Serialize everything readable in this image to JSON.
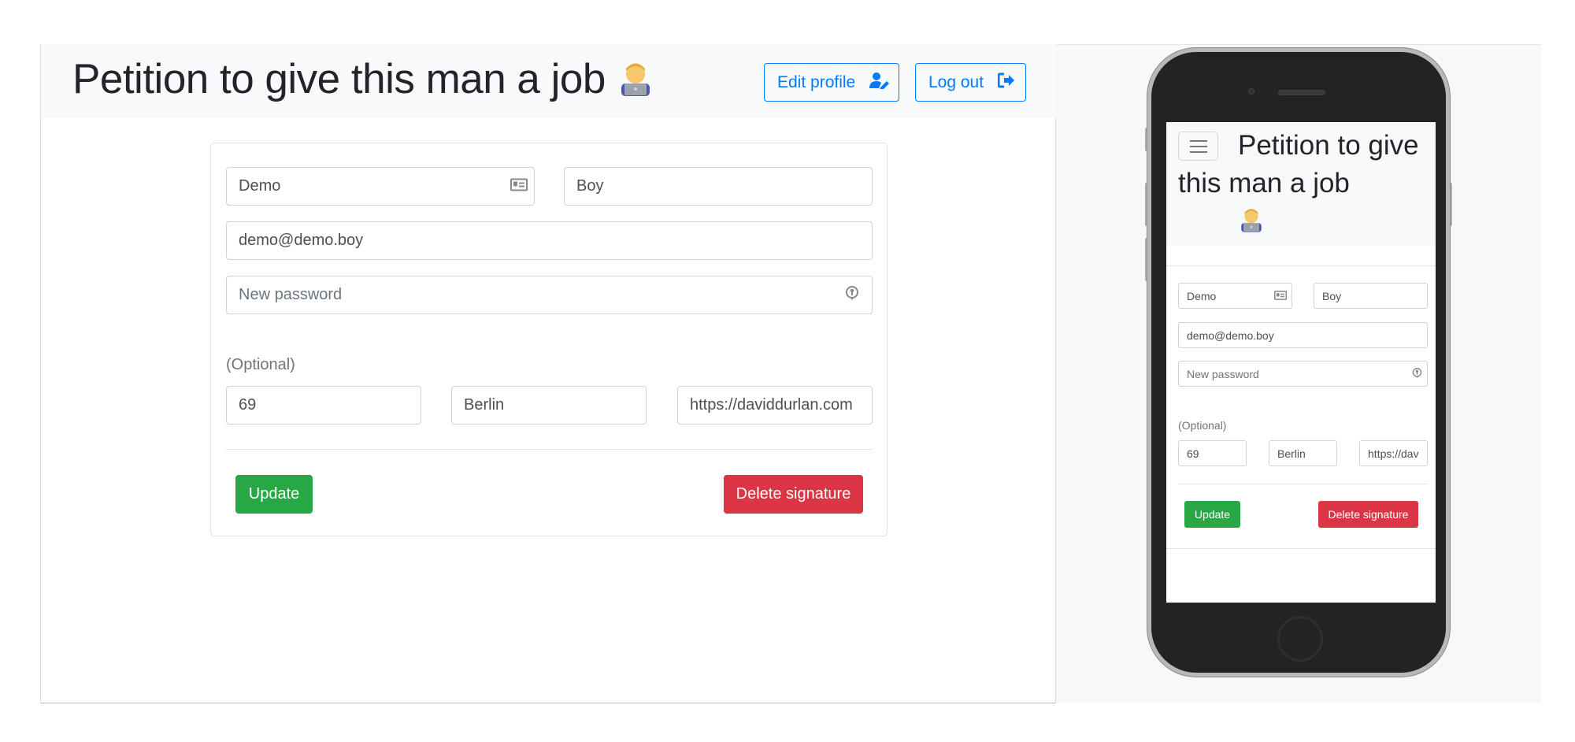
{
  "header": {
    "title": "Petition to give this man a job",
    "emoji": "👨‍💻",
    "edit_profile_label": "Edit profile",
    "logout_label": "Log out"
  },
  "form": {
    "first_name": "Demo",
    "last_name": "Boy",
    "email": "demo@demo.boy",
    "password_placeholder": "New password",
    "optional_label": "(Optional)",
    "age": "69",
    "city": "Berlin",
    "homepage": "https://daviddurlan.com",
    "homepage_mobile": "https://dav",
    "update_label": "Update",
    "delete_label": "Delete signature"
  },
  "colors": {
    "primary": "#007bff",
    "success": "#28a745",
    "danger": "#dc3545",
    "navbar_bg": "#f8f9fa"
  },
  "icons": {
    "edit_profile": "user-edit-icon",
    "logout": "sign-out-icon",
    "first_name_field": "id-card-icon",
    "password_field": "key-icon",
    "mobile_menu": "hamburger-icon"
  }
}
